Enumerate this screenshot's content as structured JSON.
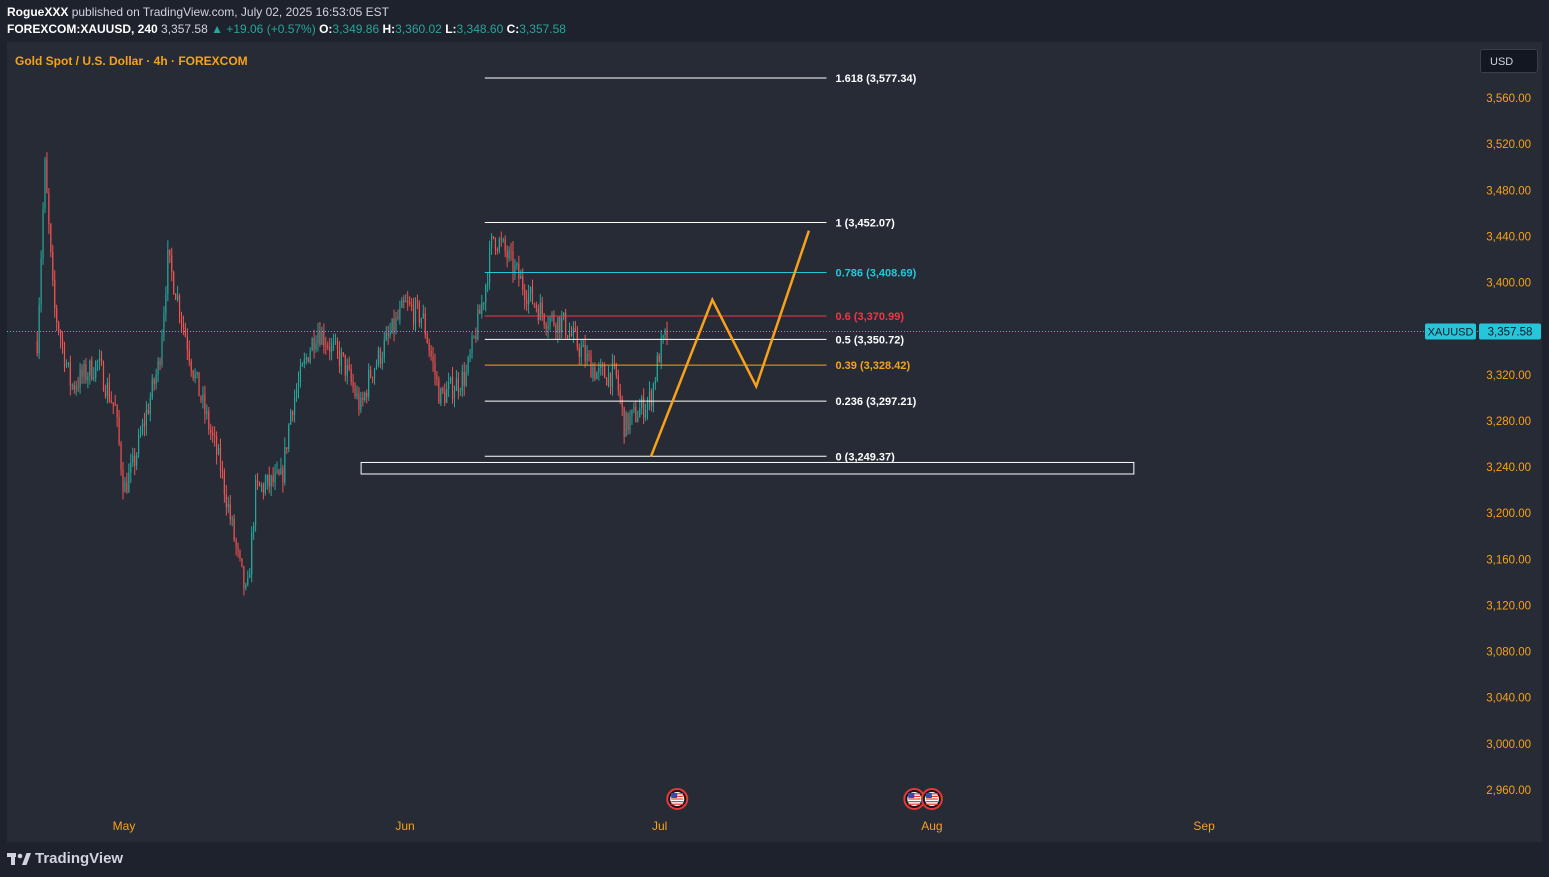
{
  "header": {
    "author": "RogueXXX",
    "published_text": "published on TradingView.com, July 02, 2025 16:53:05 EST",
    "symbol_line": "FOREXCOM:XAUUSD, 240",
    "last": "3,357.58",
    "change": "▲ +19.06 (+0.57%)",
    "o_label": "O:",
    "o_val": "3,349.86",
    "h_label": "H:",
    "h_val": "3,360.02",
    "l_label": "L:",
    "l_val": "3,348.60",
    "c_label": "C:",
    "c_val": "3,357.58"
  },
  "legend_title": "Gold Spot / U.S. Dollar · 4h · FOREXCOM",
  "currency_button": "USD",
  "price_tag": {
    "symbol": "XAUUSD",
    "price": "3,357.58"
  },
  "footer": {
    "logo_text": "TradingView"
  },
  "colors": {
    "up": "#26a69a",
    "down": "#ef5350",
    "accent": "#f7a21b",
    "panel_bg": "#262b36",
    "axis_text": "#f7a21b",
    "fib_cyan": "#26c6da",
    "fib_red": "#f23645"
  },
  "chart_data": {
    "type": "candlestick",
    "symbol": "XAUUSD",
    "timeframe": "4h",
    "y_axis_ticks": [
      "3,560.00",
      "3,520.00",
      "3,480.00",
      "3,440.00",
      "3,400.00",
      "3,320.00",
      "3,280.00",
      "3,240.00",
      "3,200.00",
      "3,160.00",
      "3,120.00",
      "3,080.00",
      "3,040.00",
      "3,000.00",
      "2,960.00"
    ],
    "y_tick_values": [
      3560,
      3520,
      3480,
      3440,
      3400,
      3320,
      3280,
      3240,
      3200,
      3160,
      3120,
      3080,
      3040,
      3000,
      2960
    ],
    "ylim": [
      2946,
      3597
    ],
    "x_axis_labels": [
      {
        "label": "May",
        "date": "2025-05-01"
      },
      {
        "label": "Jun",
        "date": "2025-06-02"
      },
      {
        "label": "Jul",
        "date": "2025-07-01"
      },
      {
        "label": "Aug",
        "date": "2025-08-01"
      },
      {
        "label": "Sep",
        "date": "2025-09-01"
      }
    ],
    "last_price": 3357.58,
    "price_path": [
      {
        "date": "2025-04-21",
        "price": 3330
      },
      {
        "date": "2025-04-22",
        "price": 3500
      },
      {
        "date": "2025-04-23",
        "price": 3380
      },
      {
        "date": "2025-04-24",
        "price": 3345
      },
      {
        "date": "2025-04-25",
        "price": 3310
      },
      {
        "date": "2025-04-28",
        "price": 3330
      },
      {
        "date": "2025-04-30",
        "price": 3290
      },
      {
        "date": "2025-05-01",
        "price": 3220
      },
      {
        "date": "2025-05-02",
        "price": 3240
      },
      {
        "date": "2025-05-05",
        "price": 3330
      },
      {
        "date": "2025-05-06",
        "price": 3420
      },
      {
        "date": "2025-05-07",
        "price": 3390
      },
      {
        "date": "2025-05-09",
        "price": 3320
      },
      {
        "date": "2025-05-12",
        "price": 3240
      },
      {
        "date": "2025-05-14",
        "price": 3160
      },
      {
        "date": "2025-05-15",
        "price": 3125
      },
      {
        "date": "2025-05-16",
        "price": 3220
      },
      {
        "date": "2025-05-19",
        "price": 3230
      },
      {
        "date": "2025-05-20",
        "price": 3290
      },
      {
        "date": "2025-05-22",
        "price": 3340
      },
      {
        "date": "2025-05-23",
        "price": 3360
      },
      {
        "date": "2025-05-26",
        "price": 3330
      },
      {
        "date": "2025-05-28",
        "price": 3290
      },
      {
        "date": "2025-05-29",
        "price": 3320
      },
      {
        "date": "2025-06-02",
        "price": 3380
      },
      {
        "date": "2025-06-04",
        "price": 3370
      },
      {
        "date": "2025-06-06",
        "price": 3300
      },
      {
        "date": "2025-06-09",
        "price": 3320
      },
      {
        "date": "2025-06-11",
        "price": 3390
      },
      {
        "date": "2025-06-12",
        "price": 3440
      },
      {
        "date": "2025-06-13",
        "price": 3432
      },
      {
        "date": "2025-06-16",
        "price": 3390
      },
      {
        "date": "2025-06-18",
        "price": 3370
      },
      {
        "date": "2025-06-20",
        "price": 3365
      },
      {
        "date": "2025-06-23",
        "price": 3330
      },
      {
        "date": "2025-06-24",
        "price": 3320
      },
      {
        "date": "2025-06-26",
        "price": 3320
      },
      {
        "date": "2025-06-27",
        "price": 3275
      },
      {
        "date": "2025-06-30",
        "price": 3300
      },
      {
        "date": "2025-07-01",
        "price": 3340
      },
      {
        "date": "2025-07-02",
        "price": 3357.58
      }
    ],
    "fib_levels": [
      {
        "ratio": "1.618",
        "price": 3577.34,
        "label": "1.618 (3,577.34)",
        "color": "#ffffff"
      },
      {
        "ratio": "1",
        "price": 3452.07,
        "label": "1 (3,452.07)",
        "color": "#ffffff"
      },
      {
        "ratio": "0.786",
        "price": 3408.69,
        "label": "0.786 (3,408.69)",
        "color": "#26c6da"
      },
      {
        "ratio": "0.6",
        "price": 3370.99,
        "label": "0.6 (3,370.99)",
        "color": "#f23645"
      },
      {
        "ratio": "0.5",
        "price": 3350.72,
        "label": "0.5 (3,350.72)",
        "color": "#ffffff"
      },
      {
        "ratio": "0.39",
        "price": 3328.42,
        "label": "0.39 (3,328.42)",
        "color": "#f7a21b"
      },
      {
        "ratio": "0.236",
        "price": 3297.21,
        "label": "0.236 (3,297.21)",
        "color": "#ffffff"
      },
      {
        "ratio": "0",
        "price": 3249.37,
        "label": "0 (3,249.37)",
        "color": "#ffffff"
      }
    ],
    "fib_start_date": "2025-06-12",
    "fib_end_date": "2025-07-20",
    "support_zone": {
      "from_date": "2025-05-28",
      "to_date": "2025-08-24",
      "top": 3244,
      "bottom": 3234
    },
    "projection_path": [
      {
        "date": "2025-06-30",
        "price": 3249
      },
      {
        "date": "2025-07-07",
        "price": 3385
      },
      {
        "date": "2025-07-12",
        "price": 3310
      },
      {
        "date": "2025-07-18",
        "price": 3445
      }
    ],
    "event_markers": [
      {
        "date": "2025-07-03",
        "flag": "US"
      },
      {
        "date": "2025-07-30",
        "flag": "US"
      },
      {
        "date": "2025-08-01",
        "flag": "US"
      }
    ]
  }
}
